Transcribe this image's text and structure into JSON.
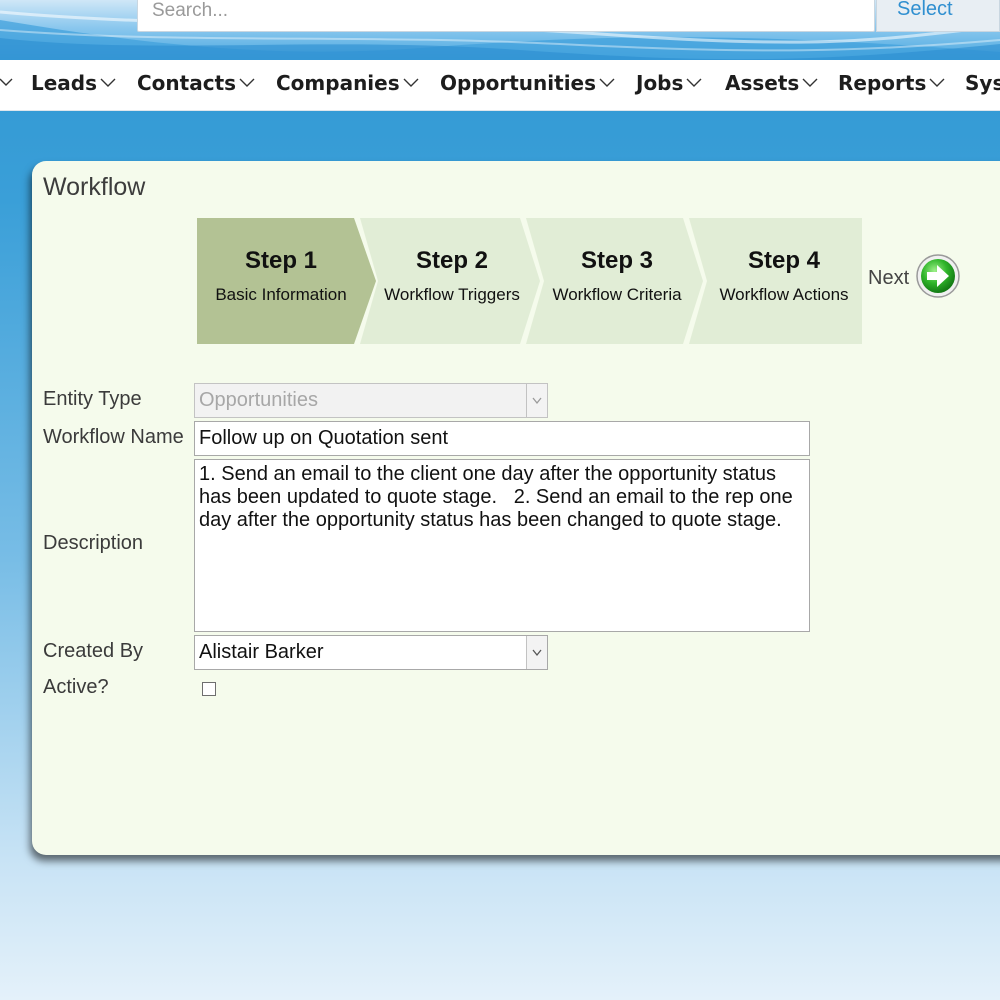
{
  "header": {
    "search_placeholder": "Search...",
    "select_label": "Select"
  },
  "nav": {
    "items": [
      {
        "label": "Leads"
      },
      {
        "label": "Contacts"
      },
      {
        "label": "Companies"
      },
      {
        "label": "Opportunities"
      },
      {
        "label": "Jobs"
      },
      {
        "label": "Assets"
      },
      {
        "label": "Reports"
      },
      {
        "label": "Sys"
      }
    ]
  },
  "panel": {
    "title": "Workflow",
    "steps": [
      {
        "num": "Step 1",
        "desc": "Basic Information",
        "active": true
      },
      {
        "num": "Step 2",
        "desc": "Workflow Triggers",
        "active": false
      },
      {
        "num": "Step 3",
        "desc": "Workflow Criteria",
        "active": false
      },
      {
        "num": "Step 4",
        "desc": "Workflow Actions",
        "active": false
      }
    ],
    "next_label": "Next"
  },
  "form": {
    "entity_type_label": "Entity Type",
    "entity_type_value": "Opportunities",
    "workflow_name_label": "Workflow Name",
    "workflow_name_value": "Follow up on Quotation sent",
    "description_label": "Description",
    "description_value": "1. Send an email to the client one day after the opportunity status has been updated to quote stage.   2. Send an email to the rep one day after the opportunity status has been changed to quote stage.",
    "created_by_label": "Created By",
    "created_by_value": "Alistair Barker",
    "active_label": "Active?",
    "active_checked": false
  },
  "colors": {
    "active_step": "#b3c294",
    "inactive_step": "#e1edd6",
    "panel_bg": "#f5fbec",
    "link_blue": "#2f8fd0"
  }
}
